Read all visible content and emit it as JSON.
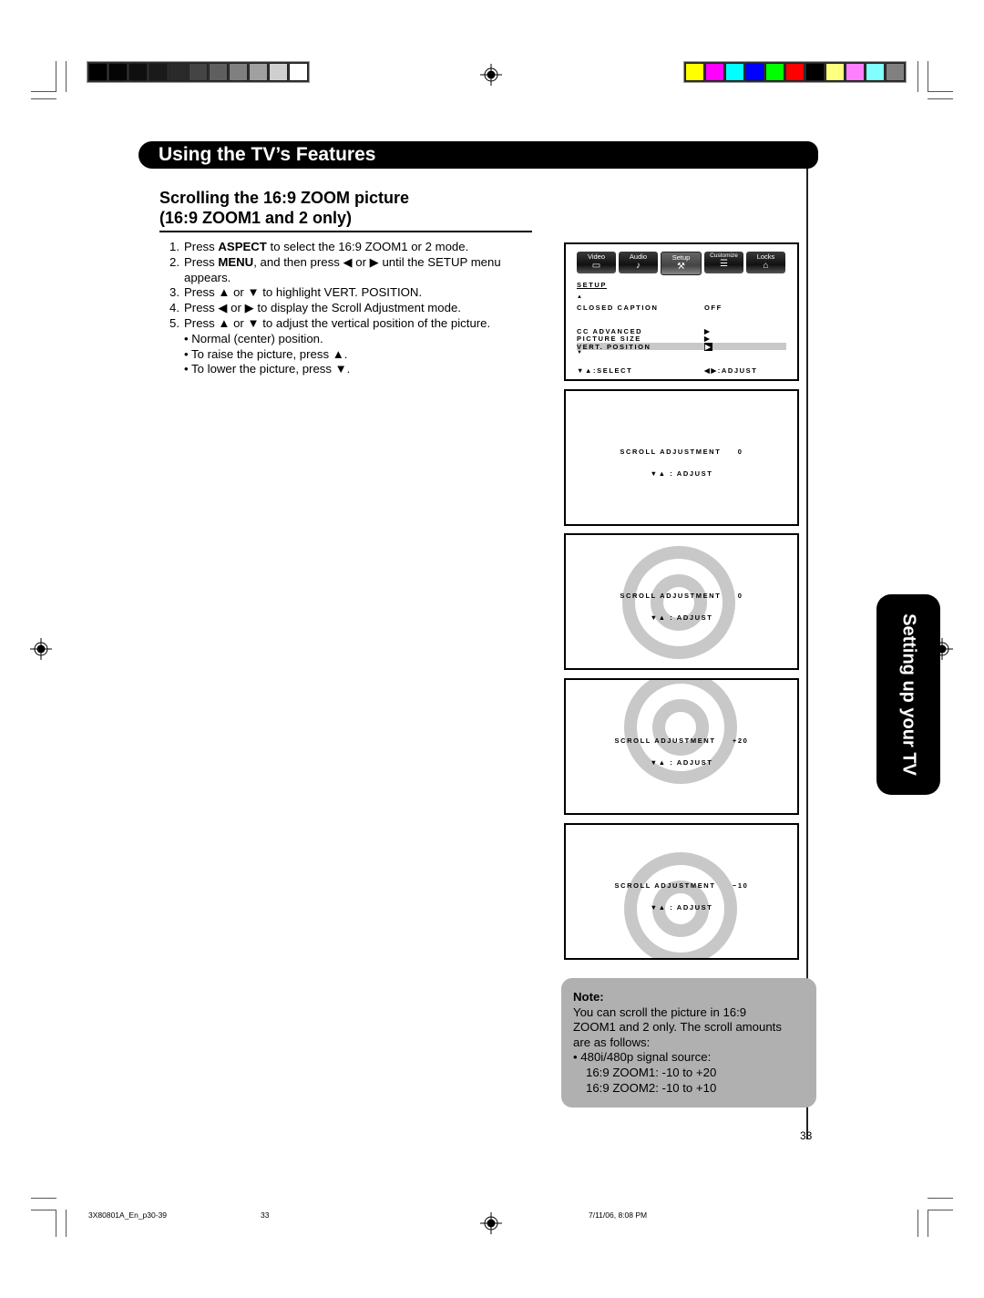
{
  "color_bars": {
    "grayscale": [
      "#000000",
      "#050505",
      "#0f0f0f",
      "#1a1a1a",
      "#2a2a2a",
      "#444444",
      "#5f5f5f",
      "#7f7f7f",
      "#a0a0a0",
      "#cfcfcf",
      "#ffffff"
    ],
    "colors": [
      "#ffff00",
      "#ff00ff",
      "#00ffff",
      "#0000ff",
      "#00ff00",
      "#ff0000",
      "#000000",
      "#ffff80",
      "#ff80ff",
      "#80ffff",
      "#808080"
    ]
  },
  "section": {
    "title": "Using the TV’s Features"
  },
  "heading": {
    "line1": "Scrolling the 16:9 ZOOM picture",
    "line2": "(16:9 ZOOM1 and 2 only)"
  },
  "steps": [
    {
      "num": "1.",
      "pre": "Press ",
      "bold": "ASPECT",
      "post": " to select the 16:9 ZOOM1 or 2 mode."
    },
    {
      "num": "2.",
      "pre": "Press ",
      "bold": "MENU",
      "post": ", and then press ◀ or ▶ until the SETUP menu"
    },
    {
      "num": "",
      "pre": "appears.",
      "bold": "",
      "post": ""
    },
    {
      "num": "3.",
      "pre": "Press ▲ or ▼ to highlight VERT. POSITION.",
      "bold": "",
      "post": ""
    },
    {
      "num": "4.",
      "pre": "Press ◀ or ▶ to display the Scroll Adjustment mode.",
      "bold": "",
      "post": ""
    },
    {
      "num": "5.",
      "pre": "Press ▲ or ▼ to adjust the vertical position of the picture.",
      "bold": "",
      "post": ""
    }
  ],
  "bullets": [
    "• Normal (center) position.",
    "• To raise the picture, press ▲.",
    "• To lower the picture, press ▼."
  ],
  "menu_screen": {
    "tabs": [
      {
        "label": "Video",
        "icon": "screen-icon",
        "glyph": "▭"
      },
      {
        "label": "Audio",
        "icon": "music-note-icon",
        "glyph": "♪"
      },
      {
        "label": "Setup",
        "icon": "wrench-icon",
        "glyph": "⚒",
        "active": true
      },
      {
        "label": "Customize",
        "icon": "list-icon",
        "glyph": "☰"
      },
      {
        "label": "Locks",
        "icon": "lock-icon",
        "glyph": "⌂"
      }
    ],
    "title": "SETUP",
    "up_arrow": "▲",
    "down_arrow": "▼",
    "rows": [
      {
        "label": "CLOSED CAPTION",
        "value": "OFF"
      },
      {
        "label": "CC ADVANCED",
        "value": "▶"
      },
      {
        "label": "PICTURE SIZE",
        "value": "▶"
      },
      {
        "label": "VERT. POSITION",
        "value": "▶",
        "highlighted": true
      }
    ],
    "footer_left": "▼▲:SELECT",
    "footer_right": "◀▶:ADJUST"
  },
  "scroll_screens": [
    {
      "label": "SCROLL ADJUSTMENT",
      "value": "0",
      "hint": "▼▲  :  ADJUST",
      "picture": "none"
    },
    {
      "label": "SCROLL ADJUSTMENT",
      "value": "0",
      "hint": "▼▲  :  ADJUST",
      "picture": "center"
    },
    {
      "label": "SCROLL ADJUSTMENT",
      "value": "+20",
      "hint": "▼▲  :  ADJUST",
      "picture": "raised"
    },
    {
      "label": "SCROLL ADJUSTMENT",
      "value": "−10",
      "hint": "▼▲  :  ADJUST",
      "picture": "lowered"
    }
  ],
  "note": {
    "title": "Note:",
    "lines": [
      "You can scroll the picture in 16:9",
      "ZOOM1 and 2 only. The scroll amounts",
      "are as follows:"
    ],
    "bullet": "•   480i/480p signal source:",
    "sub": [
      "16:9 ZOOM1: -10 to +20",
      "16:9 ZOOM2: -10 to +10"
    ]
  },
  "side_tab": {
    "label": "Setting up your TV"
  },
  "page_number": "33",
  "footer": {
    "file": "3X80801A_En_p30-39",
    "page": "33",
    "datetime": "7/11/06, 8:08 PM"
  }
}
